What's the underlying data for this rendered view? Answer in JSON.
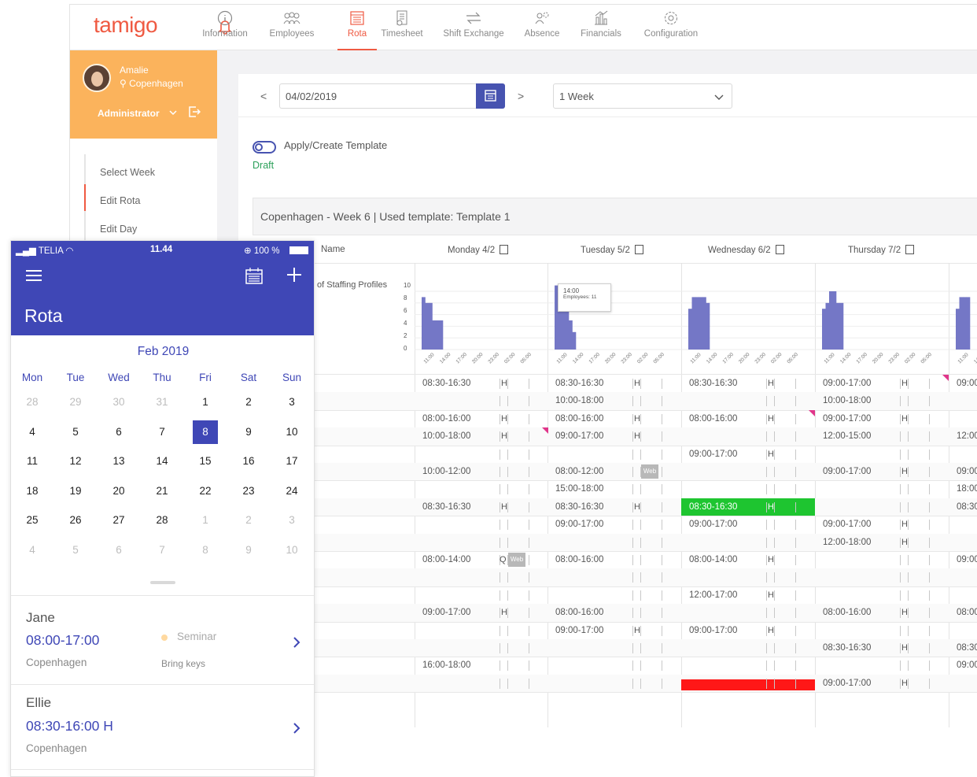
{
  "app": {
    "logo": "tamigo",
    "nav": [
      {
        "label": "Information",
        "icon": "info-icon"
      },
      {
        "label": "Employees",
        "icon": "employees-icon"
      },
      {
        "label": "Rota",
        "icon": "rota-icon",
        "active": true
      },
      {
        "label": "Timesheet",
        "icon": "timesheet-icon"
      },
      {
        "label": "Shift Exchange",
        "icon": "shift-exchange-icon"
      },
      {
        "label": "Absence",
        "icon": "absence-icon"
      },
      {
        "label": "Financials",
        "icon": "financials-icon"
      },
      {
        "label": "Configuration",
        "icon": "gear-icon"
      }
    ]
  },
  "user": {
    "name": "Amalie",
    "location": "Copenhagen",
    "role": "Administrator"
  },
  "left_menu": [
    "Select Week",
    "Edit Rota",
    "Edit Day"
  ],
  "toolbar": {
    "date": "04/02/2019",
    "period": "1 Week"
  },
  "template": {
    "toggle_label": "Apply/Create Template",
    "status": "Draft"
  },
  "schedule": {
    "title": "Copenhagen - Week 6 | Used template: Template 1",
    "name_header": "Name",
    "profile_label": "of Staffing Profiles",
    "days": [
      "Monday 4/2",
      "Tuesday 5/2",
      "Wednesday 6/2",
      "Thursday 7/2"
    ],
    "y_ticks": [
      "10",
      "8",
      "6",
      "4",
      "2",
      "0"
    ],
    "x_ticks": [
      "11:00",
      "14:00",
      "17:00",
      "20:00",
      "23:00",
      "02:00",
      "05:00"
    ],
    "tooltip": {
      "time": "14:00",
      "label": "Employees: 11"
    },
    "web_tag": "Web",
    "h_mark": "H",
    "q_mark": "Q",
    "rows": [
      [
        "08:30-16:30 H",
        "08:30-16:30 H",
        "08:30-16:30 H",
        "09:00-17:00 H",
        "09:00"
      ],
      [
        "",
        "10:00-18:00",
        "",
        "10:00-18:00",
        ""
      ],
      [
        "08:00-16:00 H",
        "08:00-16:00 H",
        "08:00-16:00 H",
        "09:00-17:00 H",
        ""
      ],
      [
        "10:00-18:00 H",
        "09:00-17:00 H",
        "",
        "12:00-15:00",
        "12:00"
      ],
      [
        "",
        "",
        "09:00-17:00 H",
        "",
        ""
      ],
      [
        "10:00-12:00",
        "08:00-12:00 Web",
        "",
        "09:00-17:00 H",
        "09:00"
      ],
      [
        "",
        "15:00-18:00",
        "",
        "",
        "18:00"
      ],
      [
        "08:30-16:30 H",
        "08:30-16:30 H",
        "08:30-16:30 H",
        "",
        "08:30"
      ],
      [
        "",
        "09:00-17:00",
        "09:00-17:00",
        "09:00-17:00 H",
        ""
      ],
      [
        "",
        "",
        "",
        "12:00-18:00 H",
        ""
      ],
      [
        "08:00-14:00 Q Web",
        "08:00-16:00",
        "08:00-14:00 H",
        "",
        "09:00"
      ],
      [
        "",
        "",
        "",
        "",
        ""
      ],
      [
        "",
        "",
        "12:00-17:00 H",
        "",
        ""
      ],
      [
        "09:00-17:00 H",
        "08:00-16:00",
        "",
        "08:00-16:00 H",
        "08:00"
      ],
      [
        "",
        "09:00-17:00 H",
        "09:00-17:00 H",
        "",
        ""
      ],
      [
        "",
        "",
        "",
        "08:30-16:30 H",
        "08:30"
      ],
      [
        "16:00-18:00",
        "",
        "",
        "",
        "09:00"
      ],
      [
        "",
        "",
        "",
        "09:00-17:00 H",
        ""
      ]
    ],
    "staffing_profiles": [
      [
        0,
        0,
        9,
        8,
        8,
        5,
        5,
        5,
        0,
        0,
        0,
        0,
        0,
        0,
        0
      ],
      [
        0,
        0,
        11,
        11,
        11,
        11,
        5,
        3,
        0,
        0,
        0,
        0,
        0,
        0,
        0
      ],
      [
        0,
        0,
        7,
        9,
        9,
        9,
        9,
        8,
        0,
        0,
        0,
        0,
        0,
        0,
        0
      ],
      [
        0,
        0,
        7,
        8,
        10,
        10,
        8,
        8,
        0,
        0,
        0,
        0,
        0,
        0,
        0
      ]
    ],
    "colors": {
      "bar": "#7477c6",
      "highlight": "#1ec530",
      "alert": "#ff1717",
      "accent": "#ef5a42"
    }
  },
  "phone": {
    "status": {
      "carrier": "TELIA",
      "time": "11.44",
      "battery": "100 %"
    },
    "title": "Rota",
    "month": "Feb 2019",
    "weekdays": [
      "Mon",
      "Tue",
      "Wed",
      "Thu",
      "Fri",
      "Sat",
      "Sun"
    ],
    "weeks": [
      [
        "28",
        "29",
        "30",
        "31",
        "1",
        "2",
        "3"
      ],
      [
        "4",
        "5",
        "6",
        "7",
        "8",
        "9",
        "10"
      ],
      [
        "11",
        "12",
        "13",
        "14",
        "15",
        "16",
        "17"
      ],
      [
        "18",
        "19",
        "20",
        "21",
        "22",
        "23",
        "24"
      ],
      [
        "25",
        "26",
        "27",
        "28",
        "1",
        "2",
        "3"
      ],
      [
        "4",
        "5",
        "6",
        "7",
        "8",
        "9",
        "10"
      ]
    ],
    "selected": "8",
    "entries": [
      {
        "name": "Jane",
        "time": "08:00-17:00",
        "location": "Copenhagen",
        "tag": "Seminar",
        "note": "Bring keys"
      },
      {
        "name": "Ellie",
        "time": "08:30-16:00 H",
        "location": "Copenhagen"
      }
    ]
  }
}
